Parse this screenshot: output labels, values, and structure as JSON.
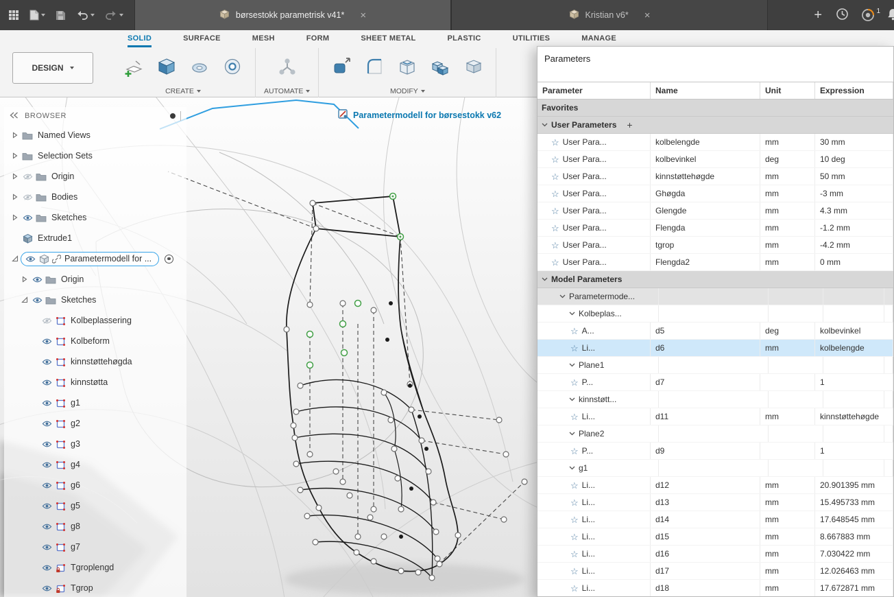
{
  "glyphs": {
    "star": "☆",
    "close": "×",
    "new_tab": "+",
    "user_plus": "+"
  },
  "titlebar": {
    "tabs": [
      {
        "label": "børsestokk parametrisk v41*",
        "active": true
      },
      {
        "label": "Kristian v6*",
        "active": false
      }
    ],
    "job_badge": "1"
  },
  "ribbon": {
    "design_label": "DESIGN",
    "tabs": [
      {
        "label": "SOLID",
        "active": true
      },
      {
        "label": "SURFACE",
        "active": false
      },
      {
        "label": "MESH",
        "active": false
      },
      {
        "label": "FORM",
        "active": false
      },
      {
        "label": "SHEET METAL",
        "active": false
      },
      {
        "label": "PLASTIC",
        "active": false
      },
      {
        "label": "UTILITIES",
        "active": false
      },
      {
        "label": "MANAGE",
        "active": false
      }
    ],
    "group_labels": {
      "create": "CREATE",
      "automate": "AUTOMATE",
      "modify": "MODIFY"
    }
  },
  "viewport": {
    "active_doc_label": "Parametermodell for børsestokk v62"
  },
  "browser": {
    "header": "BROWSER",
    "items": [
      {
        "label": "Named Views",
        "indent": 0,
        "arrow": "collapsed",
        "eye": "none",
        "icon": "folder"
      },
      {
        "label": "Selection Sets",
        "indent": 0,
        "arrow": "collapsed",
        "eye": "none",
        "icon": "folder"
      },
      {
        "label": "Origin",
        "indent": 0,
        "arrow": "collapsed",
        "eye": "off",
        "icon": "folder"
      },
      {
        "label": "Bodies",
        "indent": 0,
        "arrow": "collapsed",
        "eye": "off",
        "icon": "folder"
      },
      {
        "label": "Sketches",
        "indent": 0,
        "arrow": "collapsed",
        "eye": "on",
        "icon": "folder"
      },
      {
        "label": "Extrude1",
        "indent": 0,
        "arrow": "none",
        "eye": "none",
        "icon": "extrude"
      },
      {
        "label": "Parametermodell for ...",
        "indent": 0,
        "arrow": "expanded",
        "eye": "on",
        "icon": "component",
        "link": true,
        "selected": true,
        "radio": true
      },
      {
        "label": "Origin",
        "indent": 1,
        "arrow": "collapsed",
        "eye": "on",
        "icon": "folder"
      },
      {
        "label": "Sketches",
        "indent": 1,
        "arrow": "expanded",
        "eye": "on",
        "icon": "folder"
      },
      {
        "label": "Kolbeplassering",
        "indent": 2,
        "arrow": "none",
        "eye": "off",
        "icon": "sketch"
      },
      {
        "label": "Kolbeform",
        "indent": 2,
        "arrow": "none",
        "eye": "on",
        "icon": "sketch"
      },
      {
        "label": "kinnstøttehøgda",
        "indent": 2,
        "arrow": "none",
        "eye": "on",
        "icon": "sketch"
      },
      {
        "label": "kinnstøtta",
        "indent": 2,
        "arrow": "none",
        "eye": "on",
        "icon": "sketch"
      },
      {
        "label": "g1",
        "indent": 2,
        "arrow": "none",
        "eye": "on",
        "icon": "sketch"
      },
      {
        "label": "g2",
        "indent": 2,
        "arrow": "none",
        "eye": "on",
        "icon": "sketch"
      },
      {
        "label": "g3",
        "indent": 2,
        "arrow": "none",
        "eye": "on",
        "icon": "sketch"
      },
      {
        "label": "g4",
        "indent": 2,
        "arrow": "none",
        "eye": "on",
        "icon": "sketch"
      },
      {
        "label": "g6",
        "indent": 2,
        "arrow": "none",
        "eye": "on",
        "icon": "sketch"
      },
      {
        "label": "g5",
        "indent": 2,
        "arrow": "none",
        "eye": "on",
        "icon": "sketch"
      },
      {
        "label": "g8",
        "indent": 2,
        "arrow": "none",
        "eye": "on",
        "icon": "sketch"
      },
      {
        "label": "g7",
        "indent": 2,
        "arrow": "none",
        "eye": "on",
        "icon": "sketch"
      },
      {
        "label": "Tgroplengd",
        "indent": 2,
        "arrow": "none",
        "eye": "on",
        "icon": "sketch-locked"
      },
      {
        "label": "Tgrop",
        "indent": 2,
        "arrow": "none",
        "eye": "on",
        "icon": "sketch-locked"
      }
    ]
  },
  "parameters": {
    "title": "Parameters",
    "columns": [
      "Parameter",
      "Name",
      "Unit",
      "Expression"
    ],
    "rows": [
      {
        "type": "section",
        "label": "Favorites",
        "indent": 0,
        "chevron": false
      },
      {
        "type": "section",
        "label": "User Parameters",
        "indent": 0,
        "chevron": true,
        "plus": true
      },
      {
        "type": "param",
        "label": "User Para...",
        "name": "kolbelengde",
        "unit": "mm",
        "expr": "30 mm",
        "indent": 1
      },
      {
        "type": "param",
        "label": "User Para...",
        "name": "kolbevinkel",
        "unit": "deg",
        "expr": "10 deg",
        "indent": 1
      },
      {
        "type": "param",
        "label": "User Para...",
        "name": "kinnstøttehøgde",
        "unit": "mm",
        "expr": "50 mm",
        "indent": 1
      },
      {
        "type": "param",
        "label": "User Para...",
        "name": "Ghøgda",
        "unit": "mm",
        "expr": "-3 mm",
        "indent": 1
      },
      {
        "type": "param",
        "label": "User Para...",
        "name": "Glengde",
        "unit": "mm",
        "expr": "4.3 mm",
        "indent": 1
      },
      {
        "type": "param",
        "label": "User Para...",
        "name": "Flengda",
        "unit": "mm",
        "expr": "-1.2 mm",
        "indent": 1
      },
      {
        "type": "param",
        "label": "User Para...",
        "name": "tgrop",
        "unit": "mm",
        "expr": "-4.2 mm",
        "indent": 1
      },
      {
        "type": "param",
        "label": "User Para...",
        "name": "Flengda2",
        "unit": "mm",
        "expr": "0 mm",
        "indent": 1
      },
      {
        "type": "section",
        "label": "Model Parameters",
        "indent": 0,
        "chevron": true
      },
      {
        "type": "group",
        "label": "Parametermode...",
        "indent": 1,
        "chevron": true,
        "shaded": true
      },
      {
        "type": "group",
        "label": "Kolbeplas...",
        "indent": 2,
        "chevron": true
      },
      {
        "type": "param",
        "label": "A...",
        "name": "d5",
        "unit": "deg",
        "expr": "kolbevinkel",
        "indent": 3
      },
      {
        "type": "param",
        "label": "Li...",
        "name": "d6",
        "unit": "mm",
        "expr": "kolbelengde",
        "indent": 3,
        "selected": true
      },
      {
        "type": "group",
        "label": "Plane1",
        "indent": 2,
        "chevron": true
      },
      {
        "type": "param",
        "label": "P...",
        "name": "d7",
        "unit": "",
        "expr": "1",
        "indent": 3
      },
      {
        "type": "group",
        "label": "kinnstøtt...",
        "indent": 2,
        "chevron": true
      },
      {
        "type": "param",
        "label": "Li...",
        "name": "d11",
        "unit": "mm",
        "expr": "kinnstøttehøgde",
        "indent": 3
      },
      {
        "type": "group",
        "label": "Plane2",
        "indent": 2,
        "chevron": true
      },
      {
        "type": "param",
        "label": "P...",
        "name": "d9",
        "unit": "",
        "expr": "1",
        "indent": 3
      },
      {
        "type": "group",
        "label": "g1",
        "indent": 2,
        "chevron": true
      },
      {
        "type": "param",
        "label": "Li...",
        "name": "d12",
        "unit": "mm",
        "expr": "20.901395 mm",
        "indent": 3
      },
      {
        "type": "param",
        "label": "Li...",
        "name": "d13",
        "unit": "mm",
        "expr": "15.495733 mm",
        "indent": 3
      },
      {
        "type": "param",
        "label": "Li...",
        "name": "d14",
        "unit": "mm",
        "expr": "17.648545 mm",
        "indent": 3
      },
      {
        "type": "param",
        "label": "Li...",
        "name": "d15",
        "unit": "mm",
        "expr": "8.667883 mm",
        "indent": 3
      },
      {
        "type": "param",
        "label": "Li...",
        "name": "d16",
        "unit": "mm",
        "expr": "7.030422 mm",
        "indent": 3
      },
      {
        "type": "param",
        "label": "Li...",
        "name": "d17",
        "unit": "mm",
        "expr": "12.026463 mm",
        "indent": 3
      },
      {
        "type": "param",
        "label": "Li...",
        "name": "d18",
        "unit": "mm",
        "expr": "17.672871 mm",
        "indent": 3
      }
    ]
  }
}
